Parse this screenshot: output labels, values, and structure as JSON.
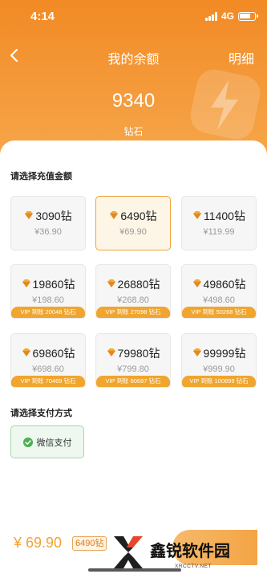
{
  "status_bar": {
    "time": "4:14",
    "network": "4G"
  },
  "header": {
    "back_icon": "chevron-left-icon",
    "title": "我的余额",
    "detail_link": "明细",
    "decoration_icon": "lightning-bolt-icon"
  },
  "balance": {
    "value": "9340",
    "unit": "钻石"
  },
  "recharge": {
    "section_title": "请选择充值金额",
    "selected_index": 1,
    "packages": [
      {
        "amount": "3090钻",
        "price": "¥36.90",
        "vip": ""
      },
      {
        "amount": "6490钻",
        "price": "¥69.90",
        "vip": ""
      },
      {
        "amount": "11400钻",
        "price": "¥119.99",
        "vip": ""
      },
      {
        "amount": "19860钻",
        "price": "¥198.60",
        "vip": "VIP 到账 20048 钻石"
      },
      {
        "amount": "26880钻",
        "price": "¥268.80",
        "vip": "VIP 到账 27098 钻石"
      },
      {
        "amount": "49860钻",
        "price": "¥498.60",
        "vip": "VIP 到账 50268 钻石"
      },
      {
        "amount": "69860钻",
        "price": "¥698.60",
        "vip": "VIP 到账 70469 钻石"
      },
      {
        "amount": "79980钻",
        "price": "¥799.80",
        "vip": "VIP 到账 80687 钻石"
      },
      {
        "amount": "99999钻",
        "price": "¥999.90",
        "vip": "VIP 到账 100899 钻石"
      }
    ]
  },
  "payment": {
    "section_title": "请选择支付方式",
    "method_label": "微信支付",
    "method_icon": "check-circle-icon"
  },
  "footer": {
    "total_price": "¥ 69.90",
    "total_diamonds": "6490钻"
  },
  "watermark": {
    "text": "鑫锐软件园",
    "sub": "XRCCTV.NET"
  },
  "colors": {
    "header_orange": "#f28a25",
    "accent": "#f0a238",
    "vip_bar": "#f0a52e",
    "wechat_green": "#4caf50"
  }
}
